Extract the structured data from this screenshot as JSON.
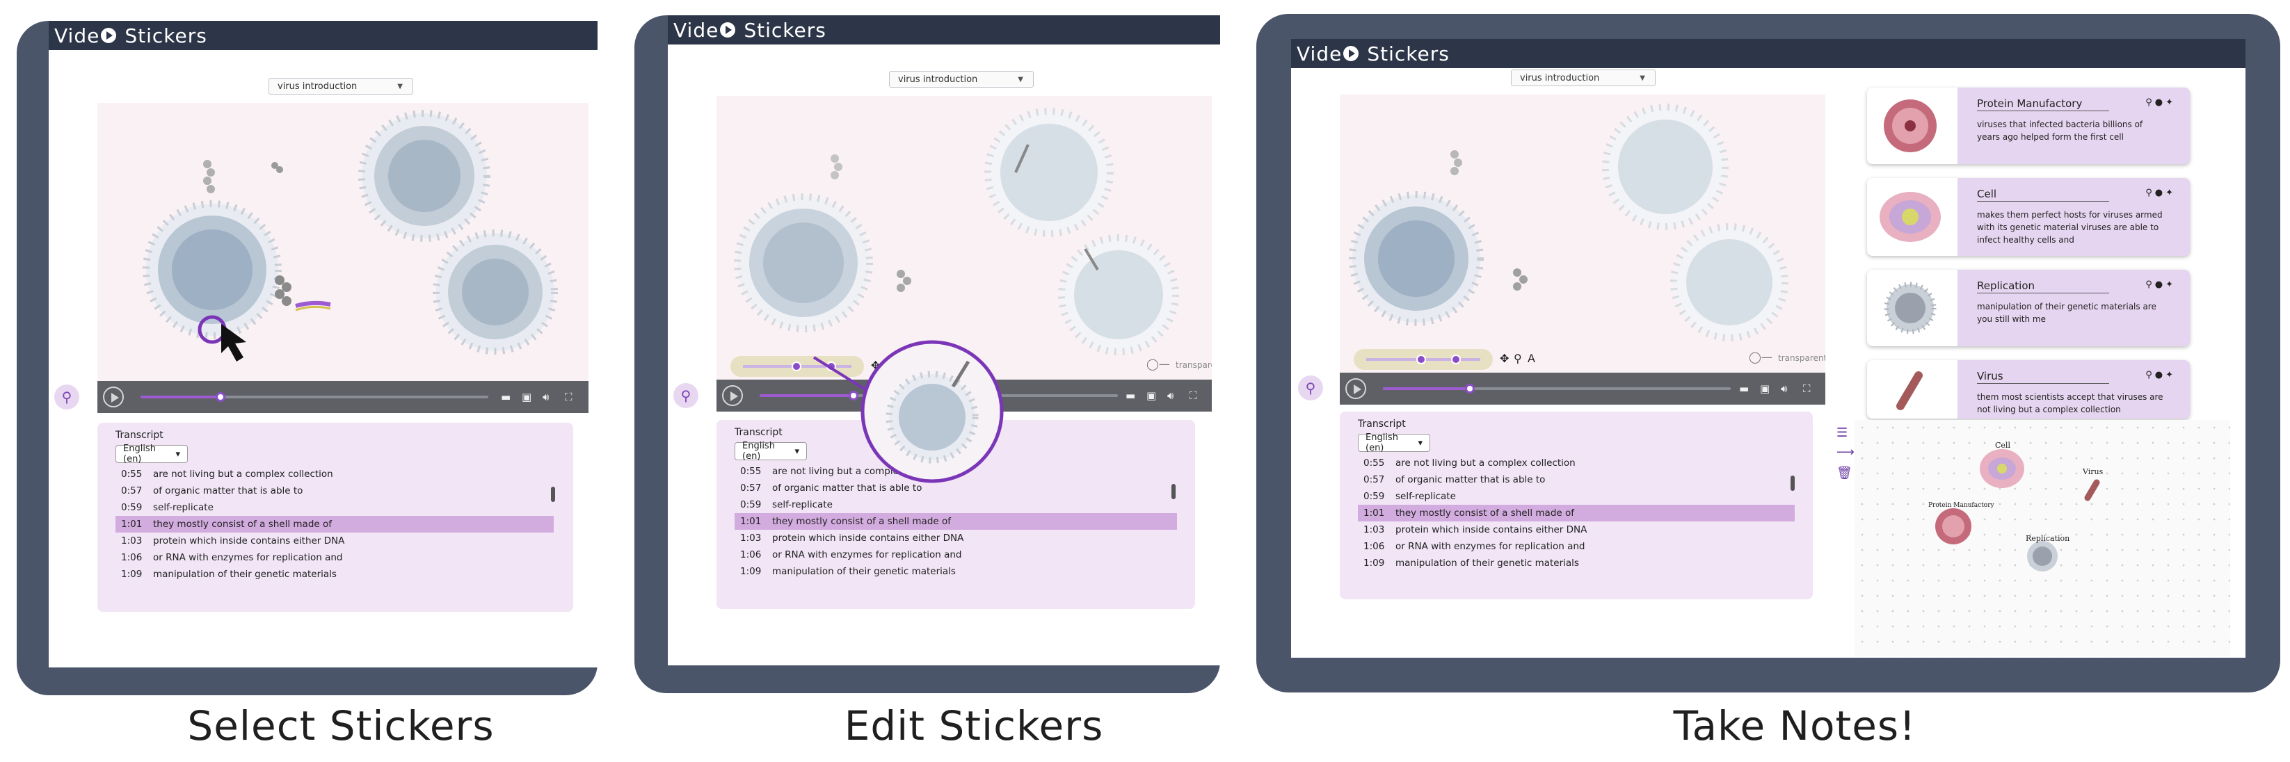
{
  "app": {
    "title_a": "Vide",
    "title_b": "Stickers"
  },
  "video_select": "virus introduction",
  "transcript": {
    "title": "Transcript",
    "language": "English (en)",
    "rows": [
      {
        "time": "0:55",
        "text": "are not living but a complex collection"
      },
      {
        "time": "0:57",
        "text": "of organic matter that is able to"
      },
      {
        "time": "0:59",
        "text": "self-replicate"
      },
      {
        "time": "1:01",
        "text": "they mostly consist of a shell made of"
      },
      {
        "time": "1:03",
        "text": "protein which inside contains either DNA"
      },
      {
        "time": "1:06",
        "text": "or RNA with enzymes for replication and"
      },
      {
        "time": "1:09",
        "text": "manipulation of their genetic materials"
      }
    ],
    "highlighted_index": 3
  },
  "player": {
    "progress_p1": 0.23,
    "progress_p2": 0.27,
    "progress_p3": 0.25
  },
  "sticker_tools": {
    "transparent_label": "transparent",
    "text_tool": "A"
  },
  "captions": {
    "p1": "Select Stickers",
    "p2": "Edit Stickers",
    "p3": "Take Notes!"
  },
  "cards": [
    {
      "title": "Protein Manufactory",
      "text": "viruses that infected bacteria billions of years ago helped form the first cell",
      "color": "#c46a7a"
    },
    {
      "title": "Cell",
      "text": "makes them perfect hosts for viruses armed with its genetic material viruses are able to infect healthy cells and",
      "color": "#e8b0c0"
    },
    {
      "title": "Replication",
      "text": "manipulation of their genetic materials are you still with me",
      "color": "#9aa1ad"
    },
    {
      "title": "Virus",
      "text": "them most scientists accept that viruses are not living but a complex collection",
      "color": "#a45a5a"
    }
  ],
  "notes_map": {
    "labels": [
      "Cell",
      "Virus",
      "Protein Manufactory",
      "Replication"
    ]
  },
  "colors": {
    "frame": "#4b5569",
    "titlebar": "#2d3648",
    "accent": "#8b4fc8",
    "highlight": "#d3acdf"
  }
}
